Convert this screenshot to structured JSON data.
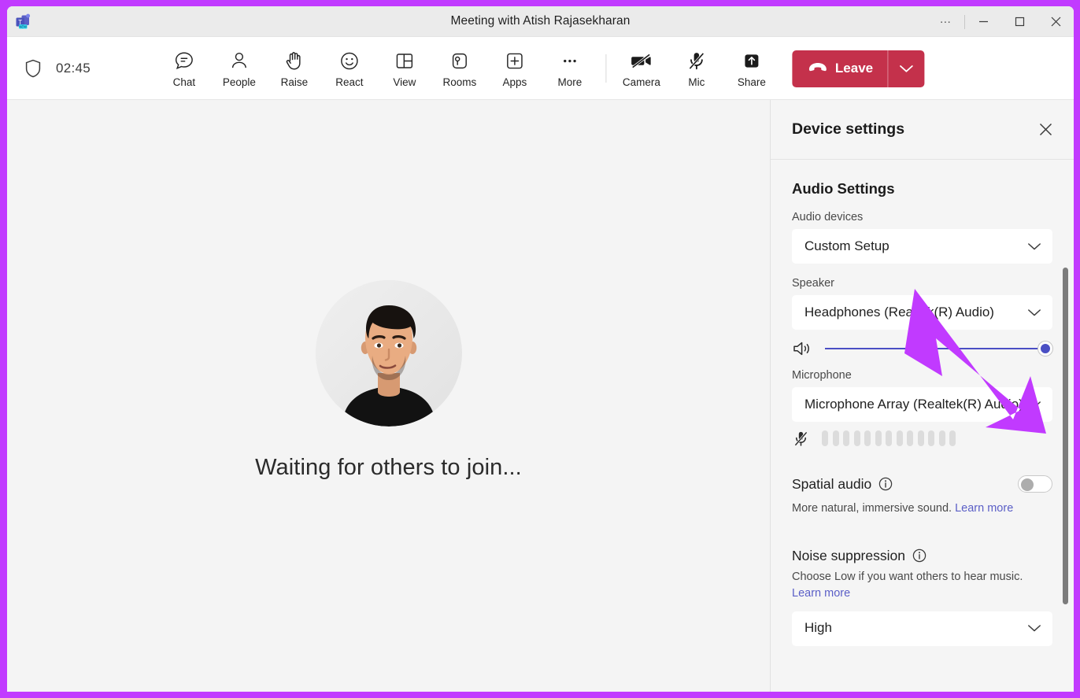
{
  "window": {
    "title": "Meeting with Atish Rajasekharan",
    "logo_icon": "teams-logo-icon",
    "more_label": "…",
    "minimize_label": "─",
    "maximize_label": "□",
    "close_label": "✕"
  },
  "toolbar": {
    "shield_icon": "shield-icon",
    "timer": "02:45",
    "items": [
      {
        "label": "Chat",
        "icon": "chat-icon"
      },
      {
        "label": "People",
        "icon": "people-icon"
      },
      {
        "label": "Raise",
        "icon": "raise-hand-icon"
      },
      {
        "label": "React",
        "icon": "react-smiley-icon"
      },
      {
        "label": "View",
        "icon": "view-grid-icon"
      },
      {
        "label": "Rooms",
        "icon": "rooms-icon"
      },
      {
        "label": "Apps",
        "icon": "apps-plus-icon"
      },
      {
        "label": "More",
        "icon": "more-ellipsis-icon"
      }
    ],
    "media": [
      {
        "label": "Camera",
        "icon": "camera-off-icon",
        "state": "off"
      },
      {
        "label": "Mic",
        "icon": "mic-off-icon",
        "state": "off"
      },
      {
        "label": "Share",
        "icon": "share-screen-icon",
        "state": "on"
      }
    ],
    "leave": {
      "label": "Leave",
      "icon": "hangup-phone-icon",
      "caret_icon": "chevron-down-icon",
      "color": "#c4314b"
    }
  },
  "stage": {
    "avatar_name": "Atish Rajasekharan",
    "status_text": "Waiting for others to join..."
  },
  "panel": {
    "title": "Device settings",
    "close_icon": "close-icon",
    "audio": {
      "section_title": "Audio Settings",
      "audio_devices_label": "Audio devices",
      "audio_devices_value": "Custom Setup",
      "speaker_label": "Speaker",
      "speaker_value": "Headphones (Realtek(R) Audio)",
      "speaker_icon": "speaker-volume-icon",
      "volume_percent": 100,
      "microphone_label": "Microphone",
      "microphone_value": "Microphone Array (Realtek(R) Audio)",
      "microphone_icon": "mic-off-icon",
      "mic_level_bars": 13,
      "mic_level_active": 0
    },
    "spatial_audio": {
      "label": "Spatial audio",
      "info_icon": "info-icon",
      "enabled": false,
      "description": "More natural, immersive sound.",
      "link": "Learn more"
    },
    "noise_suppression": {
      "label": "Noise suppression",
      "info_icon": "info-icon",
      "description": "Choose Low if you want others to hear music.",
      "link": "Learn more",
      "value": "High"
    },
    "chevron_icon": "chevron-down-icon"
  },
  "annotation": {
    "arrow_color": "#c13aff",
    "type": "arrow-pointing-to-microphone-dropdown"
  },
  "theme": {
    "accent": "#5b5fc7",
    "danger": "#c4314b",
    "border_highlight": "#c13aff",
    "panel_bg": "#f5f5f5",
    "stage_bg": "#f4f4f4"
  }
}
